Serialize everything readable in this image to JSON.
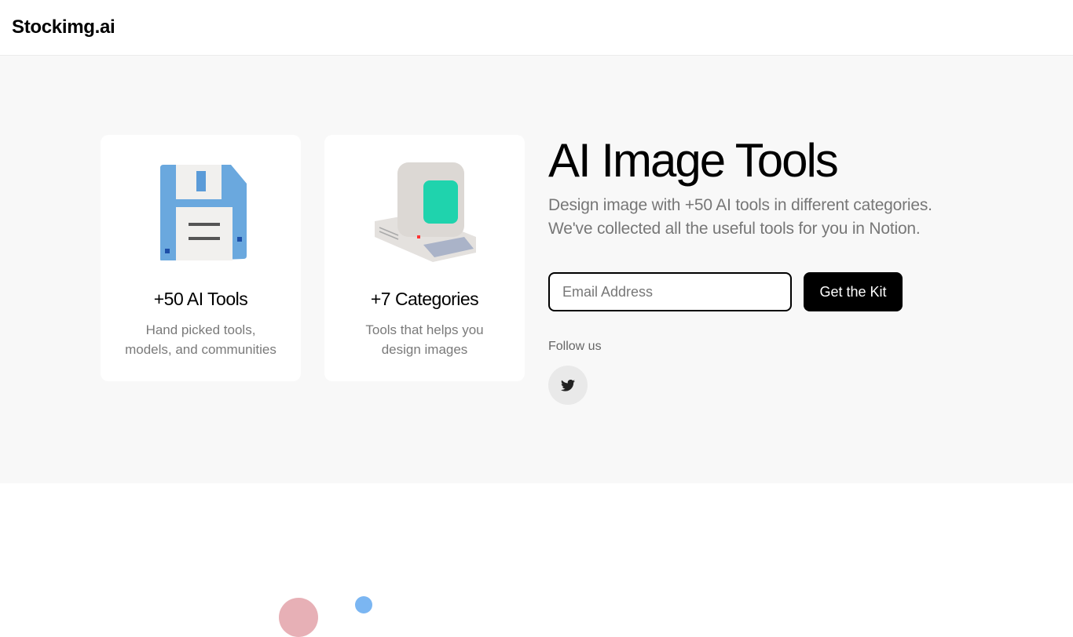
{
  "header": {
    "logo": "Stockimg.ai"
  },
  "cards": [
    {
      "icon": "floppy-disk-icon",
      "title": "+50 AI Tools",
      "desc": "Hand picked tools, models, and communities"
    },
    {
      "icon": "retro-computer-icon",
      "title": "+7 Categories",
      "desc": "Tools that helps you design images"
    }
  ],
  "hero": {
    "title": "AI Image Tools",
    "subtitle": "Design image with +50 AI tools in different categories. We've collected all the useful tools for you in Notion.",
    "email_placeholder": "Email Address",
    "cta": "Get the Kit",
    "follow": "Follow us"
  }
}
